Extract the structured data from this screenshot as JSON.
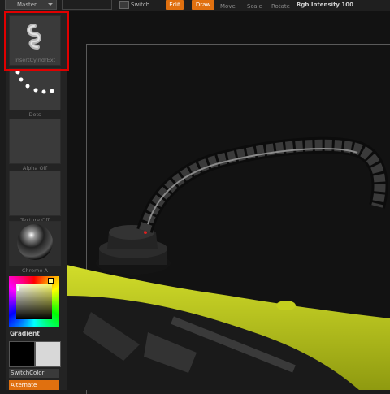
{
  "topbar": {
    "master_label": "Master",
    "switch_label": "Switch",
    "edit_label": "Edit",
    "draw_label": "Draw",
    "move_label": "Move",
    "scale_label": "Scale",
    "rotate_label": "Rotate",
    "rgb_label": "Rgb Intensity 100"
  },
  "sidebar": {
    "brush_label": "InsertCylndrExt",
    "stroke_label": "Dots",
    "alpha_label": "Alpha Off",
    "texture_label": "Texture Off",
    "material_label": "Chrome A",
    "gradient_label": "Gradient",
    "switchcolor_label": "SwitchColor",
    "alternate_label": "Alternate"
  },
  "colors": {
    "accent": "#e0700f",
    "selection": "#e00000",
    "model_yellow": "#b8c418"
  }
}
